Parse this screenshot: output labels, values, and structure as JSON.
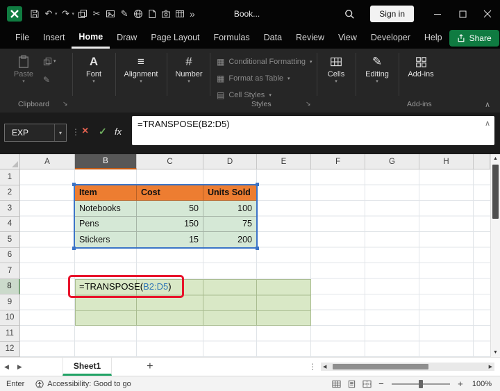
{
  "colors": {
    "titlebar_bg": "#050505",
    "ribbon_bg": "#262626",
    "excel_green": "#107C41",
    "share_green": "#0F7B41",
    "tab_underline_green": "#21A366",
    "table_header_fill": "#ED7D31",
    "table_body_fill": "#D5E8D6",
    "spill_fill": "#D9E8C6",
    "range_border_blue": "#3B74C7",
    "range_text_blue": "#2E75B6",
    "annotation_red": "#E8132B",
    "active_col_header_bg": "#575757",
    "active_col_header_accent": "#C55A11"
  },
  "glyphs": {
    "undo": "↶",
    "redo": "↷",
    "cut": "✂",
    "pencil": "✎",
    "overflow": "»",
    "dropdown": "▾",
    "collapse": "∧",
    "dots": "⋮",
    "cancel": "×",
    "check": "✓",
    "fx": "fx",
    "left": "◀",
    "right": "▶",
    "up": "▲",
    "down": "▼",
    "plus": "+",
    "minus": "−",
    "launcher": "↘",
    "font": "A",
    "alignment": "≡",
    "number": "#",
    "editing": "✎",
    "cond_format": "▦",
    "format_table": "▦",
    "cell_styles": "▤"
  },
  "title_bar": {
    "document_title": "Book...",
    "sign_in": "Sign in"
  },
  "menu": {
    "items": [
      "File",
      "Insert",
      "Home",
      "Draw",
      "Page Layout",
      "Formulas",
      "Data",
      "Review",
      "View",
      "Developer",
      "Help"
    ],
    "active_item": "Home",
    "share": "Share"
  },
  "ribbon": {
    "paste": "Paste",
    "font": "Font",
    "alignment": "Alignment",
    "number": "Number",
    "conditional_formatting": "Conditional Formatting",
    "format_as_table": "Format as Table",
    "cell_styles": "Cell Styles",
    "cells": "Cells",
    "editing": "Editing",
    "addins": "Add-ins",
    "groups": {
      "clipboard": "Clipboard",
      "styles": "Styles",
      "addins": "Add-ins"
    }
  },
  "formula_bar": {
    "name_box": "EXP",
    "formula": "=TRANSPOSE(B2:D5)"
  },
  "sheet": {
    "columns": [
      "A",
      "B",
      "C",
      "D",
      "E",
      "F",
      "G",
      "H"
    ],
    "rows": [
      "1",
      "2",
      "3",
      "4",
      "5",
      "6",
      "7",
      "8",
      "9",
      "10",
      "11",
      "12"
    ],
    "active_column": "B",
    "active_row": "8",
    "table": {
      "headers": [
        "Item",
        "Cost",
        "Units Sold"
      ],
      "rows": [
        [
          "Notebooks",
          "50",
          "100"
        ],
        [
          "Pens",
          "150",
          "75"
        ],
        [
          "Stickers",
          "15",
          "200"
        ]
      ]
    },
    "formula_cell": {
      "prefix": "=TRANSPOSE(",
      "range": "B2:D5",
      "suffix": ")"
    }
  },
  "tab_bar": {
    "sheet_tab": "Sheet1",
    "add_sheet": "+"
  },
  "status_bar": {
    "mode": "Enter",
    "accessibility": "Accessibility: Good to go",
    "zoom_level": "100%"
  }
}
